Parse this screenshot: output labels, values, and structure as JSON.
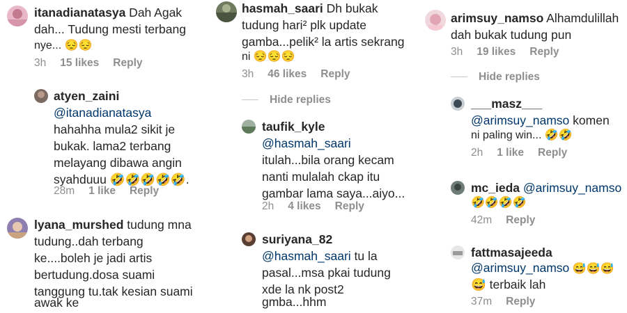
{
  "col1": {
    "c1": {
      "user": "itanadianatasya",
      "text": " Dah Agak",
      "l2": "dah... Tudung mesti terbang",
      "l3": "nye... 😔😔",
      "time": "3h",
      "likes": "15 likes",
      "reply": "Reply"
    },
    "c2": {
      "user": "atyen_zaini",
      "mention": "@itanadianatasya",
      "l2": "hahahha mula2 sikit je",
      "l3": "bukak. lama2 terbang",
      "l4": "melayang dibawa angin",
      "l5": "syahduuu 🤣🤣🤣🤣🤣.",
      "time": "28m",
      "likes": "1 like",
      "reply": "Reply"
    },
    "c3": {
      "user": "lyana_murshed",
      "text": " tudung mna",
      "l2": "tudung..dah terbang",
      "l3": "ke....boleh je jadi artis",
      "l4": "bertudung.dosa suami",
      "l5": "tanggung tu.tak kesian suami",
      "l6": "awak ke"
    }
  },
  "col2": {
    "c1": {
      "user": "hasmah_saari",
      "text": " Dh bukak",
      "l2": "tudung hari² plk update",
      "l3": "gamba...pelik² la artis sekrang",
      "l4": "ni 😔😔😔",
      "time": "3h",
      "likes": "46 likes",
      "reply": "Reply"
    },
    "hide": "Hide replies",
    "c2": {
      "user": "taufik_kyle",
      "mention": "@hasmah_saari",
      "l2": "itulah...bila orang kecam",
      "l3": "nanti mulalah ckap itu",
      "l4": "gambar lama saya...aiyo...",
      "time": "2h",
      "likes": "4 likes",
      "reply": "Reply"
    },
    "c3": {
      "user": "suriyana_82",
      "mention": "@hasmah_saari",
      "text": " tu la",
      "l2": "pasal...msa pkai tudung",
      "l3": "xde la nk post2",
      "l4": "gmba...hhm"
    }
  },
  "col3": {
    "c1": {
      "user": "arimsuy_namso",
      "text": " Alhamdulillah",
      "l2": "dah bukak tudung pun",
      "time": "3h",
      "likes": "19 likes",
      "reply": "Reply"
    },
    "hide": "Hide replies",
    "c2": {
      "user": "___masz___",
      "mention": "@arimsuy_namso",
      "text": " komen",
      "l2": "ni paling win... 🤣🤣",
      "time": "2h",
      "likes": "1 like",
      "reply": "Reply"
    },
    "c3": {
      "user": "mc_ieda",
      "mention": "@arimsuy_namso",
      "l2": "🤣🤣🤣🤣",
      "time": "42m",
      "reply": "Reply"
    },
    "c4": {
      "user": "fattmasajeeda",
      "mention": "@arimsuy_namso",
      "text": " 😅😅😅",
      "l2": "😅 terbaik lah",
      "time": "37m",
      "reply": "Reply"
    }
  },
  "colors": {
    "text": "#262626",
    "meta": "#8e8e8e",
    "mention": "#00376b"
  }
}
